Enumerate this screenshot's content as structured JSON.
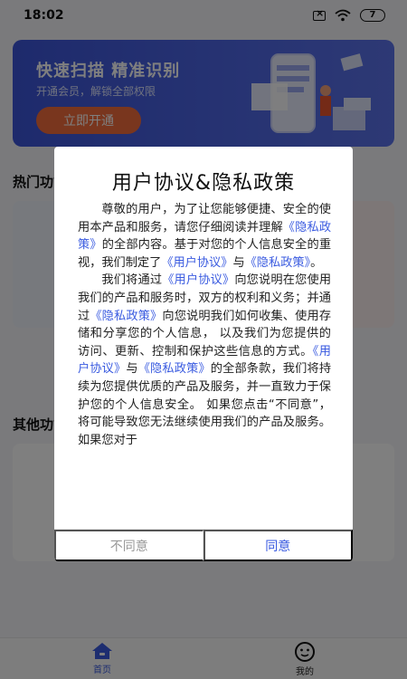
{
  "status_bar": {
    "time": "18:02",
    "battery": "7"
  },
  "banner": {
    "title": "快速扫描  精准识别",
    "subtitle": "开通会员，解锁全部权限",
    "button": "立即开通"
  },
  "sections": {
    "hot": "热门功能",
    "other": "其他功能"
  },
  "bottom_nav": [
    {
      "label": "首页",
      "icon": "home-icon",
      "active": true
    },
    {
      "label": "我的",
      "icon": "smiley-icon",
      "active": false
    }
  ],
  "dialog": {
    "title": "用户协议&隐私政策",
    "p1": {
      "t1": "尊敬的用户，为了让您能够便捷、安全的使用本产品和服务，请您仔细阅读并理解",
      "l1": "《隐私政策》",
      "t2": "的全部内容。基于对您的个人信息安全的重视，我们制定了",
      "l2": "《用户协议》",
      "t3": "与",
      "l3": "《隐私政策》",
      "t4": "。"
    },
    "p2": {
      "t1": "我们将通过",
      "l1": "《用户协议》",
      "t2": "向您说明在您使用我们的产品和服务时，双方的权利和义务；并通过",
      "l2": "《隐私政策》",
      "t3": "向您说明我们如何收集、使用存储和分享您的个人信息， 以及我们为您提供的访问、更新、控制和保护这些信息的方式。",
      "l3": "《用户协议》",
      "t4": "与",
      "l4": "《隐私政策》",
      "t5": "的全部条款，我们将持续为您提供优质的产品及服务，并一直致力于保护您的个人信息安全。 如果您点击“不同意”，将可能导致您无法继续使用我们的产品及服务。如果您对于"
    },
    "disagree": "不同意",
    "agree": "同意"
  },
  "colors": {
    "accent": "#3a5be0",
    "banner": "#4e67e6",
    "cta": "#f36c3c"
  }
}
